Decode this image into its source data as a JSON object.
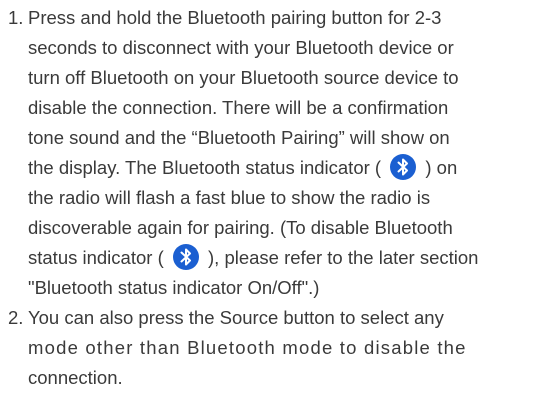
{
  "colors": {
    "text": "#3a3a3a",
    "bluetooth_icon_bg": "#1b5fd1"
  },
  "icons": [
    "bluetooth-icon"
  ],
  "instructions": [
    {
      "number": "1.",
      "lines": {
        "l1": "Press and hold the Bluetooth pairing button for 2-3",
        "l2": "seconds to disconnect with your Bluetooth device or",
        "l3": "turn off Bluetooth on your Bluetooth source device to",
        "l4": "disable the connection. There will be a confirmation",
        "l5": "tone sound and the “Bluetooth Pairing” will show on",
        "l6a": "the display. The Bluetooth status indicator (",
        "l6b": ") on",
        "l7": "the radio will flash a fast blue to show the radio is",
        "l8": "discoverable again for pairing. (To disable Bluetooth",
        "l9a": "status indicator (",
        "l9b": "), please refer to the later section",
        "l10": "\"Bluetooth status indicator On/Off\".)"
      }
    },
    {
      "number": "2.",
      "lines": {
        "l1": "You can also press the Source button to select any",
        "l2": "mode other than Bluetooth mode to disable the",
        "l3": "connection."
      }
    }
  ]
}
